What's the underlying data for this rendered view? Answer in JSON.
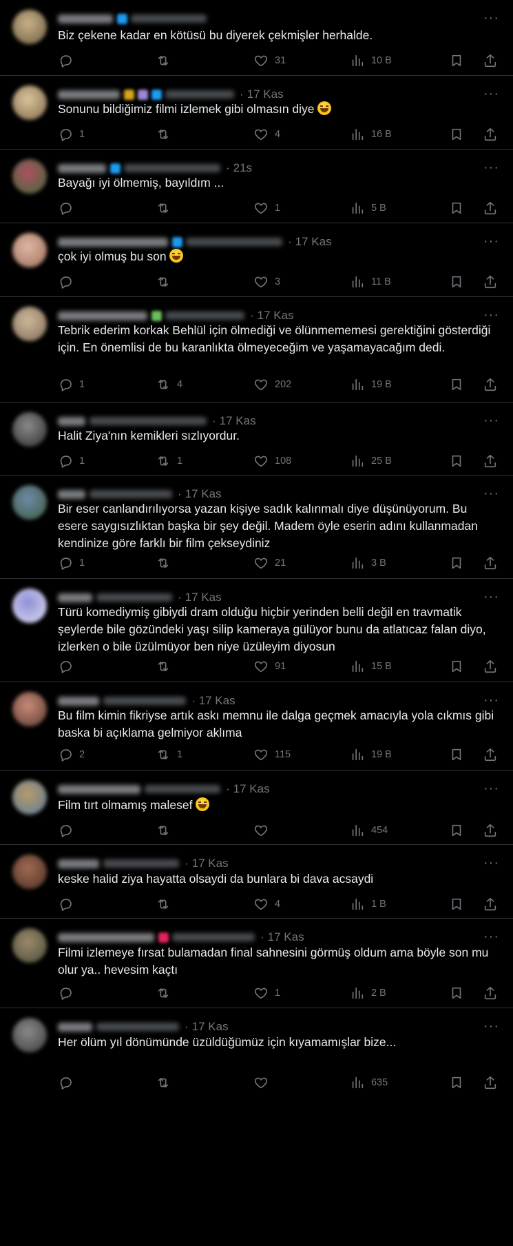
{
  "icons": {
    "reply": "reply-icon",
    "retweet": "retweet-icon",
    "like": "heart-icon",
    "views": "views-icon",
    "bookmark": "bookmark-icon",
    "share": "share-icon",
    "more": "more-icon"
  },
  "colors": {
    "background": "#000000",
    "text": "#e7e9ea",
    "muted": "#71767b",
    "divider": "#2f3336"
  },
  "more_label": "···",
  "dot": "·",
  "replies": [
    {
      "time": "",
      "text": "Biz çekene kadar en kötüsü bu diyerek çekmişler herhalde.",
      "emoji": "",
      "replies": "",
      "retweets": "",
      "likes": "31",
      "views": "10 B"
    },
    {
      "time": "17 Kas",
      "text": "Sonunu bildiğimiz filmi izlemek gibi olmasın diye",
      "emoji": "joy",
      "replies": "1",
      "retweets": "",
      "likes": "4",
      "views": "16 B"
    },
    {
      "time": "21s",
      "text": "Bayağı iyi ölmemiş, bayıldım ...",
      "emoji": "",
      "replies": "",
      "retweets": "",
      "likes": "1",
      "views": "5 B"
    },
    {
      "time": "17 Kas",
      "text": "çok iyi olmuş bu son",
      "emoji": "joy",
      "replies": "",
      "retweets": "",
      "likes": "3",
      "views": "11 B"
    },
    {
      "time": "17 Kas",
      "text": "Tebrik ederim korkak Behlül için ölmediği ve ölünmememesi gerektiğini gösterdiği için. En önemlisi de bu karanlıkta ölmeyeceğim ve yaşamayacağım dedi.",
      "emoji": "",
      "replies": "1",
      "retweets": "4",
      "likes": "202",
      "views": "19 B"
    },
    {
      "time": "17 Kas",
      "text": "Halit Ziya'nın kemikleri sızlıyordur.",
      "emoji": "",
      "replies": "1",
      "retweets": "1",
      "likes": "108",
      "views": "25 B"
    },
    {
      "time": "17 Kas",
      "text": "Bir eser canlandırılıyorsa yazan kişiye sadık kalınmalı diye düşünüyorum. Bu esere saygısızlıktan başka bir şey değil. Madem öyle eserin adını kullanmadan kendinize göre farklı bir film çekseydiniz",
      "emoji": "",
      "replies": "1",
      "retweets": "",
      "likes": "21",
      "views": "3 B"
    },
    {
      "time": "17 Kas",
      "text": "Türü komediymiş gibiydi dram olduğu hiçbir yerinden belli değil en travmatik şeylerde bile gözündeki yaşı silip kameraya gülüyor bunu da atlatıcaz falan diyo, izlerken o bile üzülmüyor ben niye üzüleyim diyosun",
      "emoji": "",
      "replies": "",
      "retweets": "",
      "likes": "91",
      "views": "15 B"
    },
    {
      "time": "17 Kas",
      "text": "Bu film kimin fikriyse artık askı memnu ile dalga geçmek amacıyla yola cıkmıs gibi baska bi açıklama gelmiyor aklıma",
      "emoji": "",
      "replies": "2",
      "retweets": "1",
      "likes": "115",
      "views": "19 B"
    },
    {
      "time": "17 Kas",
      "text": "Film tırt olmamış malesef",
      "emoji": "sweat",
      "replies": "",
      "retweets": "",
      "likes": "",
      "views": "454"
    },
    {
      "time": "17 Kas",
      "text": "keske halid ziya hayatta olsaydi da bunlara bi dava acsaydi",
      "emoji": "",
      "replies": "",
      "retweets": "",
      "likes": "4",
      "views": "1 B"
    },
    {
      "time": "17 Kas",
      "text": "Filmi izlemeye fırsat bulamadan final sahnesini görmüş oldum ama böyle son mu olur ya.. hevesim kaçtı",
      "emoji": "",
      "replies": "",
      "retweets": "",
      "likes": "1",
      "views": "2 B"
    },
    {
      "time": "17 Kas",
      "text": "Her ölüm yıl dönümünde üzüldüğümüz için kıyamamışlar bize...",
      "emoji": "",
      "replies": "",
      "retweets": "",
      "likes": "",
      "views": "635"
    }
  ]
}
